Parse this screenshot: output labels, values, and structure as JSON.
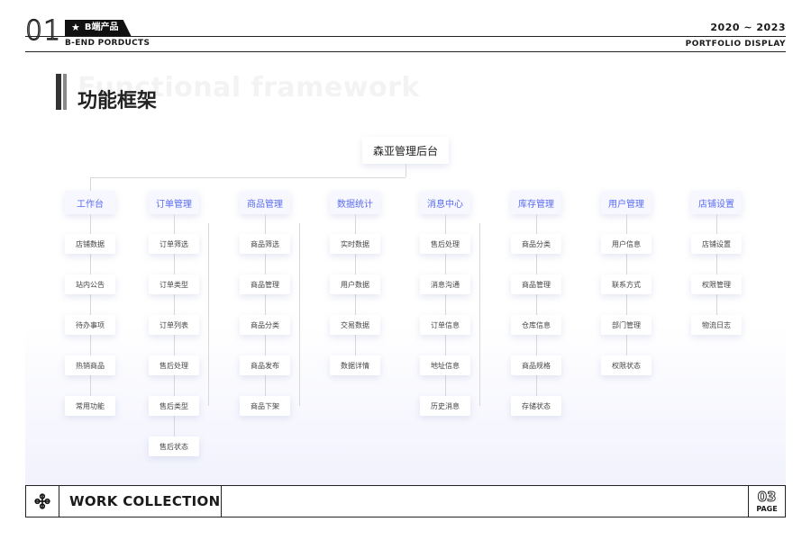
{
  "header": {
    "number": "01",
    "tag": "B端产品",
    "years": "2020 ~ 2023",
    "subtitle_left": "B-END PORDUCTS",
    "subtitle_right": "PORTFOLIO  DISPLAY"
  },
  "section": {
    "title_ghost": "Functional framework",
    "title": "功能框架"
  },
  "diagram": {
    "root": "森亚管理后台",
    "columns": [
      {
        "label": "工作台",
        "items": [
          "店铺数据",
          "站内公告",
          "待办事项",
          "热销商品",
          "常用功能"
        ]
      },
      {
        "label": "订单管理",
        "items": [
          "订单筛选",
          "订单类型",
          "订单列表",
          "售后处理",
          "售后类型",
          "售后状态"
        ]
      },
      {
        "label": "商品管理",
        "items": [
          "商品筛选",
          "商品管理",
          "商品分类",
          "商品发布",
          "商品下架"
        ]
      },
      {
        "label": "数据统计",
        "items": [
          "实时数据",
          "用户数据",
          "交易数据",
          "数据详情"
        ]
      },
      {
        "label": "消息中心",
        "items": [
          "售后处理",
          "消息沟通",
          "订单信息",
          "地址信息",
          "历史消息"
        ]
      },
      {
        "label": "库存管理",
        "items": [
          "商品分类",
          "商品管理",
          "仓库信息",
          "商品规格",
          "存储状态"
        ]
      },
      {
        "label": "用户管理",
        "items": [
          "用户信息",
          "联系方式",
          "部门管理",
          "权限状态"
        ]
      },
      {
        "label": "店铺设置",
        "items": [
          "店铺设置",
          "权限管理",
          "物流日志"
        ]
      }
    ]
  },
  "footer": {
    "icon": "network-icon",
    "title": "WORK COLLECTION",
    "page_number": "03",
    "page_label": "PAGE"
  }
}
